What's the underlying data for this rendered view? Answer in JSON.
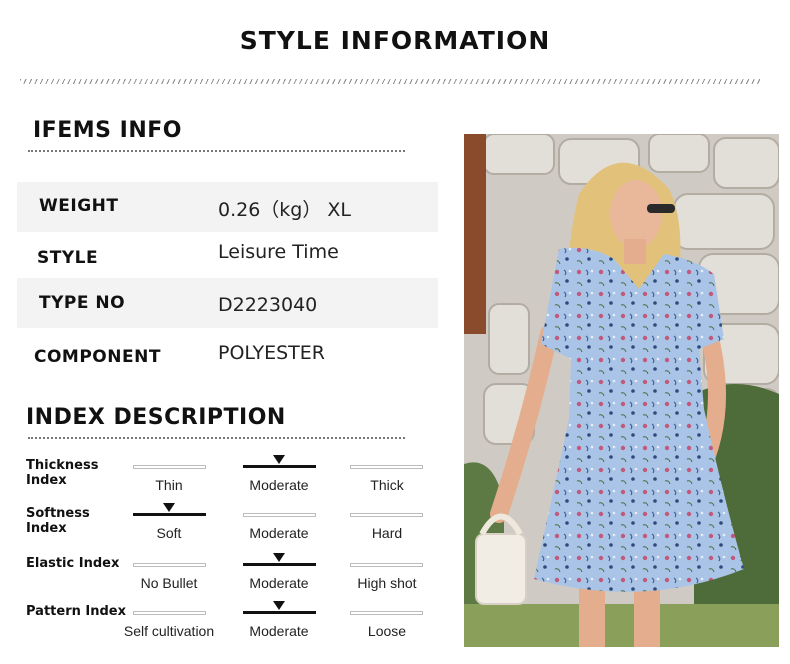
{
  "page_title": "STYLE INFORMATION",
  "items_info": {
    "heading": "IFEMS INFO",
    "rows": [
      {
        "label": "WEIGHT",
        "value": "0.26（kg） XL"
      },
      {
        "label": "STYLE",
        "value": "Leisure Time"
      },
      {
        "label": "TYPE NO",
        "value": "D2223040"
      },
      {
        "label": "COMPONENT",
        "value": "POLYESTER"
      }
    ]
  },
  "index_description": {
    "heading": "INDEX DESCRIPTION",
    "indices": [
      {
        "label": "Thickness Index",
        "options": [
          "Thin",
          "Moderate",
          "Thick"
        ],
        "selected": 1
      },
      {
        "label": "Softness Index",
        "options": [
          "Soft",
          "Moderate",
          "Hard"
        ],
        "selected": 0
      },
      {
        "label": "Elastic Index",
        "options": [
          "No Bullet",
          "Moderate",
          "High shot"
        ],
        "selected": 1
      },
      {
        "label": "Pattern Index",
        "options": [
          "Self cultivation",
          "Moderate",
          "Loose"
        ],
        "selected": 1
      }
    ]
  },
  "photo": {
    "icon": "model-photo"
  },
  "colors": {
    "dress": "#a9c4e6",
    "accent": "#111111"
  }
}
